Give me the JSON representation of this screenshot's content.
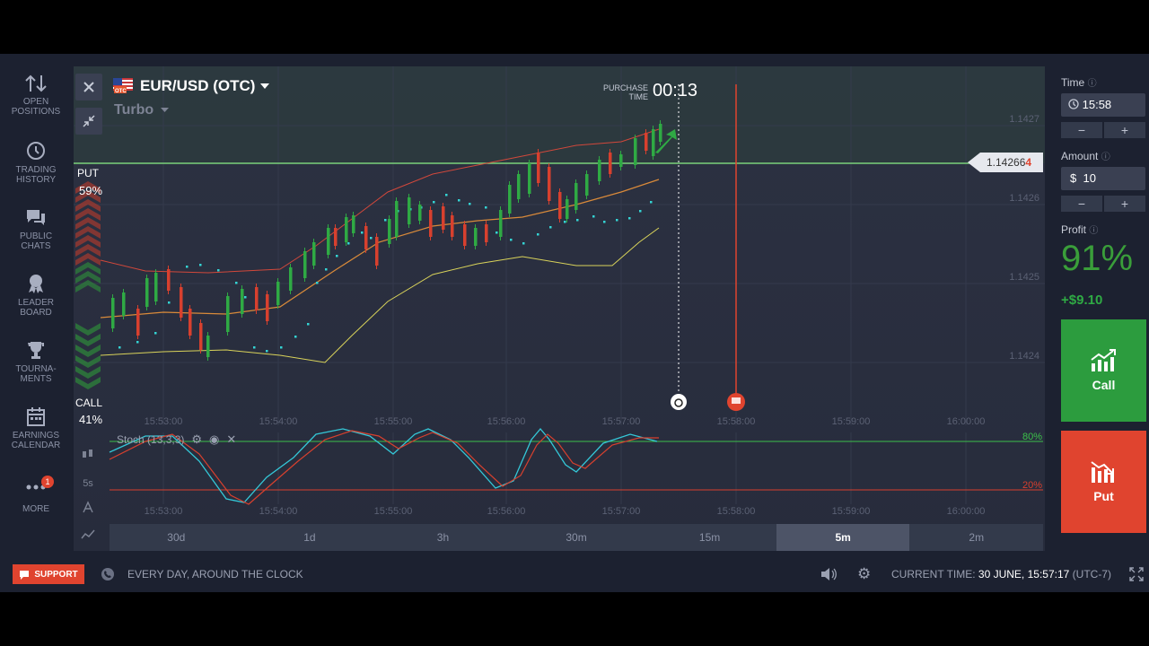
{
  "sidebar": {
    "items": [
      {
        "label": "OPEN\nPOSITIONS",
        "l1": "OPEN",
        "l2": "POSITIONS",
        "icon": "arrows-up-down-icon"
      },
      {
        "l1": "TRADING",
        "l2": "HISTORY",
        "icon": "history-icon"
      },
      {
        "l1": "PUBLIC",
        "l2": "CHATS",
        "icon": "chat-icon"
      },
      {
        "l1": "LEADER",
        "l2": "BOARD",
        "icon": "leaderboard-icon"
      },
      {
        "l1": "TOURNA-",
        "l2": "MENTS",
        "icon": "trophy-icon"
      },
      {
        "l1": "EARNINGS",
        "l2": "CALENDAR",
        "icon": "calendar-icon"
      },
      {
        "l1": "MORE",
        "l2": "",
        "icon": "more-icon",
        "badge": "1"
      }
    ]
  },
  "chart": {
    "asset": "EUR/USD (OTC)",
    "flag_text": "OTC",
    "mode": "Turbo",
    "purchase_label_1": "PURCHASE",
    "purchase_label_2": "TIME",
    "purchase_time": "00:13",
    "put_label": "PUT",
    "put_pct": "59%",
    "call_label": "CALL",
    "call_pct": "41%",
    "current_price_main": "1.14266",
    "current_price_last": "4",
    "price_ticks": [
      "1.1427",
      "1.1426",
      "1.1425",
      "1.1424"
    ],
    "time_ticks": [
      "15:53:00",
      "15:54:00",
      "15:55:00",
      "15:56:00",
      "15:57:00",
      "15:58:00",
      "15:59:00",
      "16:00:00"
    ],
    "stoch_label": "Stoch (13,3,3)",
    "stoch_levels": [
      "80%",
      "20%"
    ],
    "left_tools": [
      "5s"
    ],
    "timeframes": [
      "30d",
      "1d",
      "3h",
      "30m",
      "15m",
      "5m",
      "2m"
    ],
    "active_timeframe": "5m"
  },
  "right_panel": {
    "time_label": "Time",
    "time_value": "15:58",
    "amount_label": "Amount",
    "amount_currency": "$",
    "amount_value": "10",
    "minus": "−",
    "plus": "+",
    "profit_label": "Profit",
    "profit_pct": "91%",
    "profit_amount": "+$9.10",
    "call_label": "Call",
    "put_label": "Put"
  },
  "footer": {
    "support": "SUPPORT",
    "message": "EVERY DAY, AROUND THE CLOCK",
    "current_time_label": "CURRENT TIME:",
    "current_time_value": "30 JUNE, 15:57:17",
    "tz": "(UTC-7)"
  },
  "colors": {
    "call": "#2c9c3e",
    "put": "#e0442f",
    "bg": "#1c2130"
  }
}
